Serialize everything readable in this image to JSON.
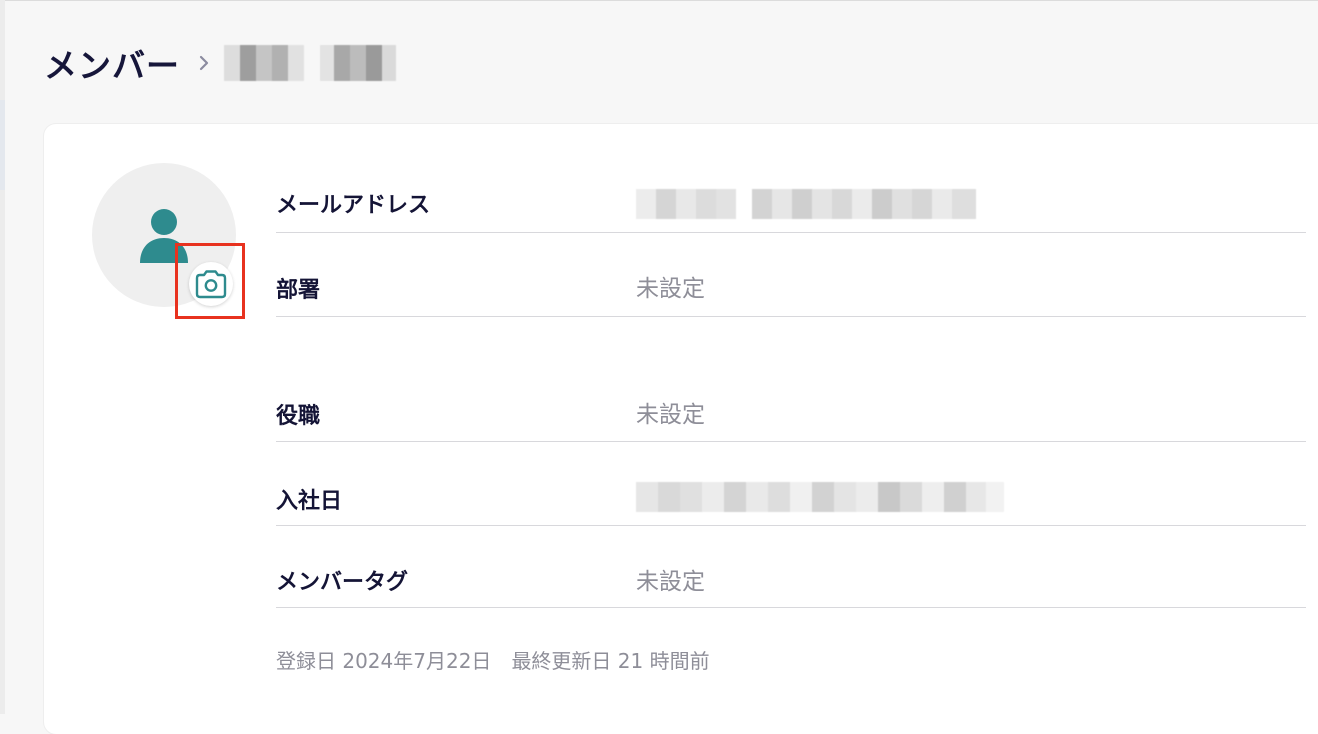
{
  "breadcrumb": {
    "section": "メンバー",
    "separator": "›"
  },
  "profile": {
    "avatar_icon": "person-icon",
    "camera_icon": "camera-icon"
  },
  "fields": {
    "email": {
      "label": "メールアドレス"
    },
    "department": {
      "label": "部署",
      "value": "未設定"
    },
    "position": {
      "label": "役職",
      "value": "未設定"
    },
    "join_date": {
      "label": "入社日"
    },
    "member_tag": {
      "label": "メンバータグ",
      "value": "未設定"
    }
  },
  "footer": {
    "registered": "登録日 2024年7月22日",
    "updated": "最終更新日 21 時間前"
  },
  "colors": {
    "accent": "#2e8b8e",
    "highlight": "#e8321f",
    "text_dark": "#141436",
    "text_muted": "#8e8e98"
  }
}
